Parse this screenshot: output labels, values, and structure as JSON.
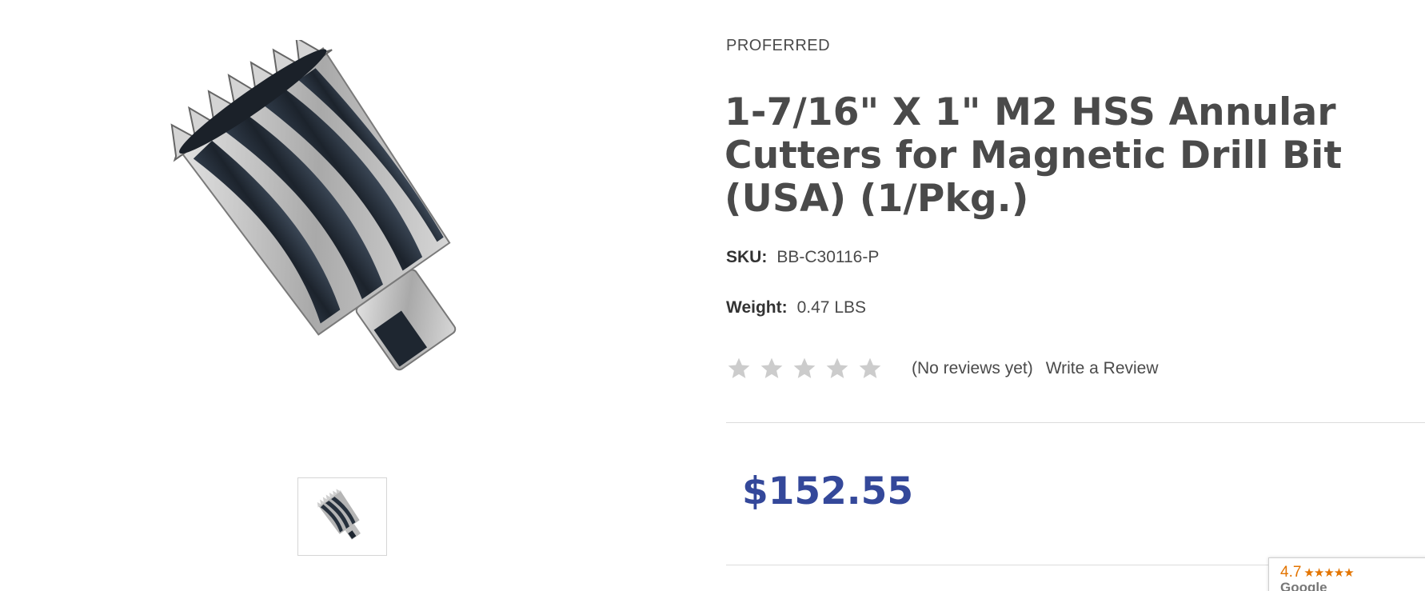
{
  "product": {
    "brand": "PROFERRED",
    "title": "1-7/16\" X 1\" M2 HSS Annular Cutters for Magnetic Drill Bit (USA) (1/Pkg.)",
    "sku_label": "SKU:",
    "sku_value": "BB-C30116-P",
    "weight_label": "Weight:",
    "weight_value": "0.47 LBS",
    "price": "$152.55",
    "image_alt": "annular-cutter-product-image"
  },
  "reviews": {
    "rating": 0,
    "max_rating": 5,
    "no_reviews_text": "(No reviews yet)",
    "write_review_label": "Write a Review"
  },
  "google_badge": {
    "rating": "4.7",
    "stars": "★★★★★",
    "source": "Google"
  },
  "colors": {
    "price": "#34489a",
    "text": "#4a4a4a",
    "star_empty": "#cccccc",
    "badge_accent": "#e37400"
  }
}
